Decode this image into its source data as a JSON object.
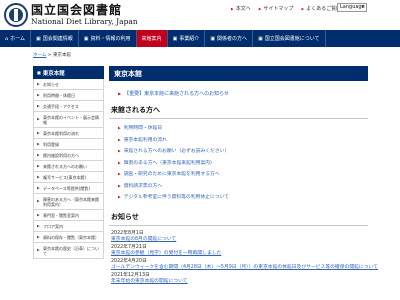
{
  "header": {
    "logo_jp": "国立国会図書館",
    "logo_en": "National Diet Library, Japan",
    "util_links": [
      "本文へ",
      "サイトマップ",
      "よくあるご質問"
    ],
    "language": "Language"
  },
  "nav": {
    "items": [
      {
        "icon": "⌂",
        "label": "ホーム",
        "active": false
      },
      {
        "icon": "▣",
        "label": "国会関連情報",
        "active": false
      },
      {
        "icon": "▣",
        "label": "資料・情報の利用",
        "active": false
      },
      {
        "icon": "",
        "label": "来館案内",
        "active": true
      },
      {
        "icon": "▣",
        "label": "事業紹介",
        "active": false
      },
      {
        "icon": "▣",
        "label": "関係者の方へ",
        "active": false
      },
      {
        "icon": "▣",
        "label": "国立国会図書館について",
        "active": false
      }
    ]
  },
  "breadcrumb": {
    "home": "ホーム",
    "sep": " > ",
    "current": "東京本館"
  },
  "sidebar": {
    "title": "東京本館",
    "items": [
      "お知らせ",
      "利用時間・休館日",
      "交通手段・アクセス",
      "東京本館のイベント・展示会情報",
      "東京本館利用の流れ",
      "利用登録",
      "館内施設利用の方へ",
      "来館される方へのお願い",
      "複写サービス(東京本館)",
      "データベース等提供(閲覧)",
      "障害のある方へ（東京本館来館利用案内）",
      "専門室・閲覧室案内",
      "フロア案内",
      "資料の保存・閲覧（東京本館）",
      "東京本館の歴史（沿革）について"
    ]
  },
  "main": {
    "title": "東京本館",
    "notice": "【重要】東京本館に来館される方へのお知らせ",
    "section_visitors": "来館される方へ",
    "links": [
      "利用時間・休館日",
      "東京本館利用の流れ",
      "来館される方へのお願い（必ずお読みください）",
      "障害のある方へ（東京本館来館利用案内）",
      "調査・研究のために東京本館を利用する方へ",
      "資料請求票の方へ",
      "デジタル参考室に伴う資料等の利用休止について"
    ],
    "section_news": "お知らせ",
    "news": [
      {
        "date": "2022年8月1日",
        "text": "東京本館の8月の開館について"
      },
      {
        "date": "2022年7月21日",
        "text": "東京本館の参観（見学）の受付を一時再開しました"
      },
      {
        "date": "2022年4月20日",
        "text": "ゴールデンウィークを含む期間（4月28日（木）～5月9日（月））の東京本館の休館日及びサービス等の確保の開館について"
      },
      {
        "date": "2021年12月13日",
        "text": "年末年始の東京本館の開館について"
      }
    ]
  },
  "colors": {
    "navy": "#002d6e",
    "accent_red": "#c2001d",
    "link_blue": "#3366bb"
  }
}
